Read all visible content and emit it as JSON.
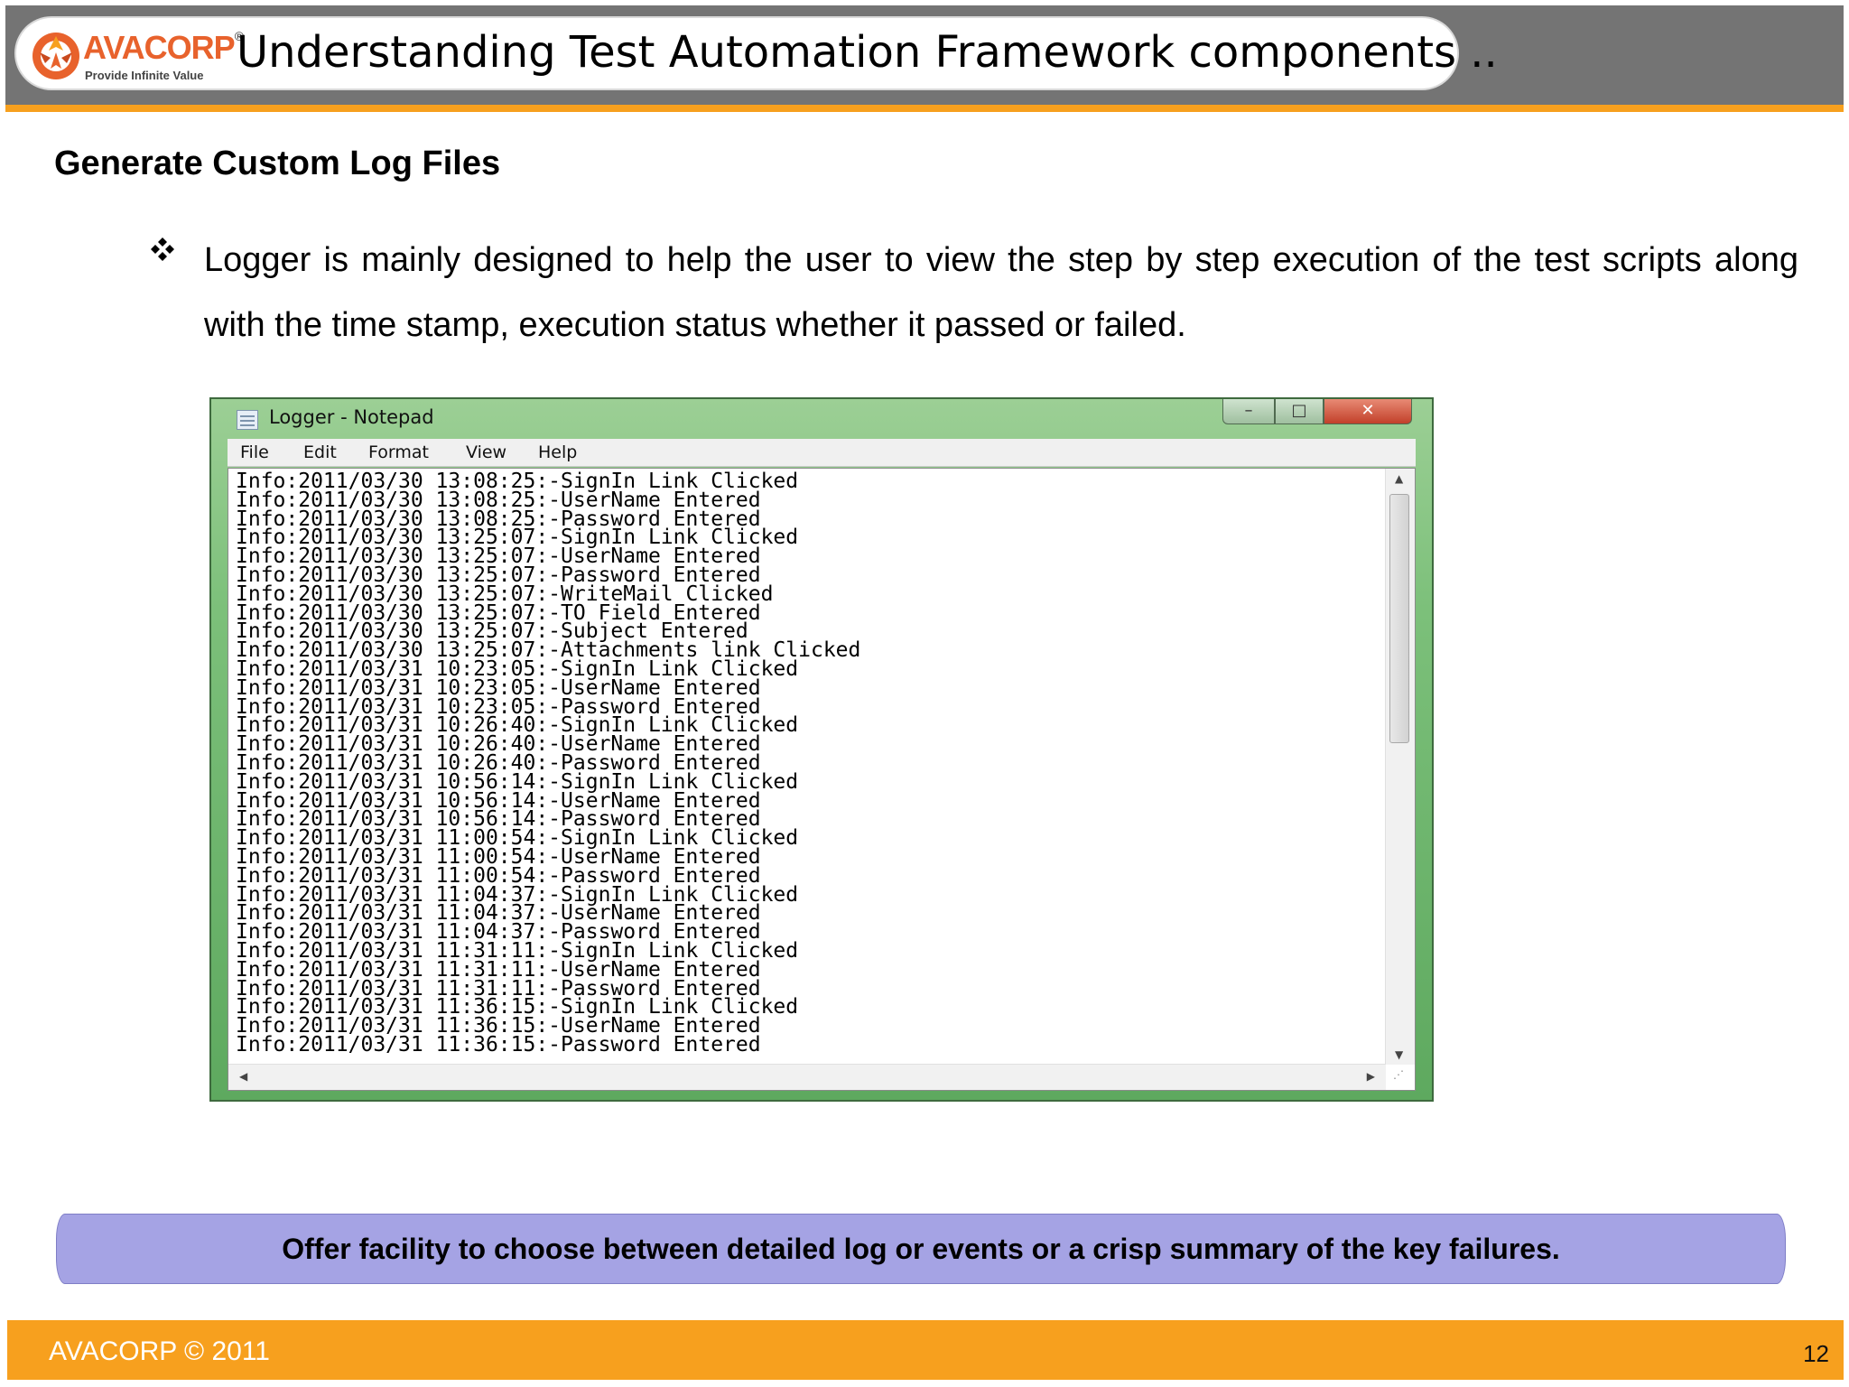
{
  "header": {
    "logo": {
      "brand": "AVACORP",
      "registered": "®",
      "tagline": "Provide Infinite Value"
    },
    "title": "Understanding Test Automation Framework components .."
  },
  "content": {
    "subtitle": "Generate Custom Log Files",
    "bullet": "Logger is mainly designed to help the user to view the step by step execution of the test scripts along with the time stamp, execution status whether it passed or failed."
  },
  "notepad": {
    "title": "Logger - Notepad",
    "controls": {
      "minimize": "–",
      "maximize": "□",
      "close": "✕"
    },
    "menu": [
      "File",
      "Edit",
      "Format",
      "View",
      "Help"
    ],
    "log_lines": [
      "Info:2011/03/30 13:08:25:-SignIn Link Clicked",
      "Info:2011/03/30 13:08:25:-UserName Entered",
      "Info:2011/03/30 13:08:25:-Password Entered",
      "Info:2011/03/30 13:25:07:-SignIn Link Clicked",
      "Info:2011/03/30 13:25:07:-UserName Entered",
      "Info:2011/03/30 13:25:07:-Password Entered",
      "Info:2011/03/30 13:25:07:-WriteMail Clicked",
      "Info:2011/03/30 13:25:07:-TO Field Entered",
      "Info:2011/03/30 13:25:07:-Subject Entered",
      "Info:2011/03/30 13:25:07:-Attachments link Clicked",
      "Info:2011/03/31 10:23:05:-SignIn Link Clicked",
      "Info:2011/03/31 10:23:05:-UserName Entered",
      "Info:2011/03/31 10:23:05:-Password Entered",
      "Info:2011/03/31 10:26:40:-SignIn Link Clicked",
      "Info:2011/03/31 10:26:40:-UserName Entered",
      "Info:2011/03/31 10:26:40:-Password Entered",
      "Info:2011/03/31 10:56:14:-SignIn Link Clicked",
      "Info:2011/03/31 10:56:14:-UserName Entered",
      "Info:2011/03/31 10:56:14:-Password Entered",
      "Info:2011/03/31 11:00:54:-SignIn Link Clicked",
      "Info:2011/03/31 11:00:54:-UserName Entered",
      "Info:2011/03/31 11:00:54:-Password Entered",
      "Info:2011/03/31 11:04:37:-SignIn Link Clicked",
      "Info:2011/03/31 11:04:37:-UserName Entered",
      "Info:2011/03/31 11:04:37:-Password Entered",
      "Info:2011/03/31 11:31:11:-SignIn Link Clicked",
      "Info:2011/03/31 11:31:11:-UserName Entered",
      "Info:2011/03/31 11:31:11:-Password Entered",
      "Info:2011/03/31 11:36:15:-SignIn Link Clicked",
      "Info:2011/03/31 11:36:15:-UserName Entered",
      "Info:2011/03/31 11:36:15:-Password Entered"
    ]
  },
  "callout": {
    "text": "Offer facility to choose between detailed log or events or a crisp summary of the key failures."
  },
  "footer": {
    "copyright": "AVACORP © 2011",
    "page_number": "12"
  },
  "colors": {
    "header_gray": "#747474",
    "accent_orange": "#f7a01e",
    "callout_lavender": "#a5a3e4",
    "window_green": "#7cc07a"
  }
}
